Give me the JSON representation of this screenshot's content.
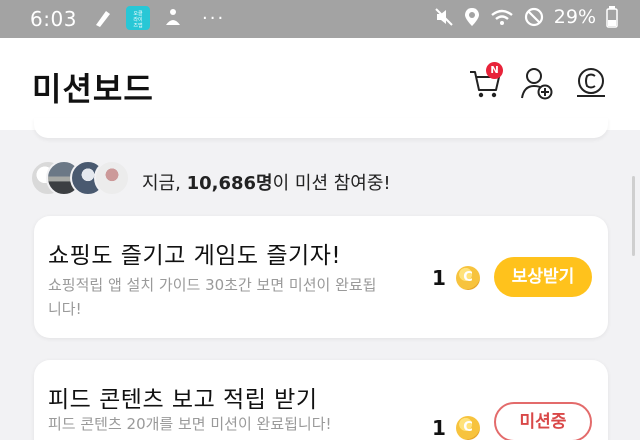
{
  "status_bar": {
    "time": "6:03",
    "app_icon_text": "오클\n라이\n즈앱",
    "more": "···",
    "battery_percent": "29%"
  },
  "header": {
    "title": "미션보드",
    "cart_badge": "N"
  },
  "participants": {
    "prefix": "지금, ",
    "count": "10,686명",
    "suffix": "이 미션 참여중!"
  },
  "missions": [
    {
      "title": "쇼핑도 즐기고 게임도 즐기자!",
      "description": "쇼핑적립 앱 설치 가이드 30초간 보면 미션이 완료됩니다!",
      "reward": "1",
      "coin_symbol": "C",
      "button_label": "보상받기",
      "status": "claimable"
    },
    {
      "title": "피드 콘텐츠 보고 적립 받기",
      "description": "피드 콘텐츠 20개를 보면 미션이 완료됩니다!",
      "reward": "1",
      "coin_symbol": "C",
      "button_label": "미션중",
      "status": "in-progress"
    }
  ],
  "colors": {
    "claim_button": "#ffc21c",
    "in_progress_border": "#e36b6b",
    "badge": "#e8233a",
    "status_bar": "#a3a3a3"
  }
}
